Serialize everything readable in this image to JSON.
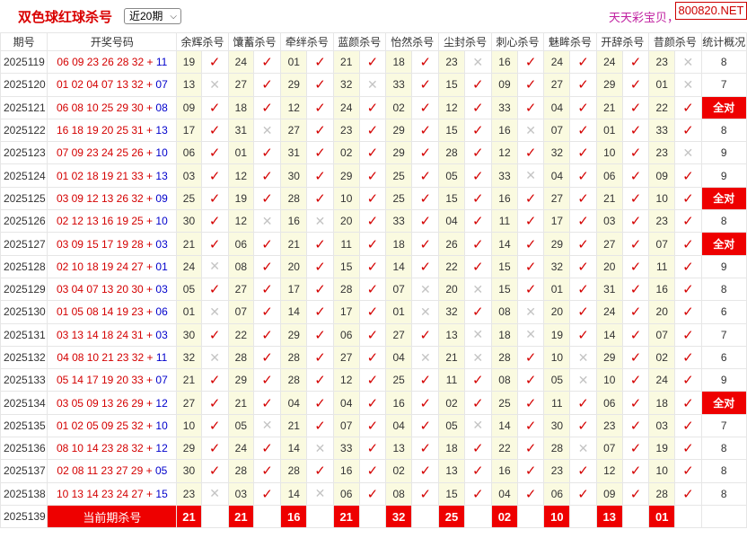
{
  "header": {
    "title": "双色球红球杀号",
    "period_select": "近20期",
    "brand": "天天彩宝贝，",
    "watermark": "800820.NET"
  },
  "columns": [
    "期号",
    "开奖号码",
    "余辉杀号",
    "馕蓄杀号",
    "牵绊杀号",
    "蓝颜杀号",
    "怡然杀号",
    "尘封杀号",
    "刺心杀号",
    "魅眸杀号",
    "开辞杀号",
    "昔颜杀号",
    "统计概况"
  ],
  "rows": [
    {
      "p": "2025119",
      "red": "06 09 23 26 28 32",
      "blue": "11",
      "k": [
        [
          "19",
          1
        ],
        [
          "24",
          1
        ],
        [
          "01",
          1
        ],
        [
          "21",
          1
        ],
        [
          "18",
          1
        ],
        [
          "23",
          0
        ],
        [
          "16",
          1
        ],
        [
          "24",
          1
        ],
        [
          "24",
          1
        ],
        [
          "23",
          0
        ]
      ],
      "s": "8"
    },
    {
      "p": "2025120",
      "red": "01 02 04 07 13 32",
      "blue": "07",
      "k": [
        [
          "13",
          0
        ],
        [
          "27",
          1
        ],
        [
          "29",
          1
        ],
        [
          "32",
          0
        ],
        [
          "33",
          1
        ],
        [
          "15",
          1
        ],
        [
          "09",
          1
        ],
        [
          "27",
          1
        ],
        [
          "29",
          1
        ],
        [
          "01",
          0
        ]
      ],
      "s": "7"
    },
    {
      "p": "2025121",
      "red": "06 08 10 25 29 30",
      "blue": "08",
      "k": [
        [
          "09",
          1
        ],
        [
          "18",
          1
        ],
        [
          "12",
          1
        ],
        [
          "24",
          1
        ],
        [
          "02",
          1
        ],
        [
          "12",
          1
        ],
        [
          "33",
          1
        ],
        [
          "04",
          1
        ],
        [
          "21",
          1
        ],
        [
          "22",
          1
        ]
      ],
      "s": "全对"
    },
    {
      "p": "2025122",
      "red": "16 18 19 20 25 31",
      "blue": "13",
      "k": [
        [
          "17",
          1
        ],
        [
          "31",
          0
        ],
        [
          "27",
          1
        ],
        [
          "23",
          1
        ],
        [
          "29",
          1
        ],
        [
          "15",
          1
        ],
        [
          "16",
          0
        ],
        [
          "07",
          1
        ],
        [
          "01",
          1
        ],
        [
          "33",
          1
        ]
      ],
      "s": "8"
    },
    {
      "p": "2025123",
      "red": "07 09 23 24 25 26",
      "blue": "10",
      "k": [
        [
          "06",
          1
        ],
        [
          "01",
          1
        ],
        [
          "31",
          1
        ],
        [
          "02",
          1
        ],
        [
          "29",
          1
        ],
        [
          "28",
          1
        ],
        [
          "12",
          1
        ],
        [
          "32",
          1
        ],
        [
          "10",
          1
        ],
        [
          "23",
          0
        ]
      ],
      "s": "9"
    },
    {
      "p": "2025124",
      "red": "01 02 18 19 21 33",
      "blue": "13",
      "k": [
        [
          "03",
          1
        ],
        [
          "12",
          1
        ],
        [
          "30",
          1
        ],
        [
          "29",
          1
        ],
        [
          "25",
          1
        ],
        [
          "05",
          1
        ],
        [
          "33",
          0
        ],
        [
          "04",
          1
        ],
        [
          "06",
          1
        ],
        [
          "09",
          1
        ]
      ],
      "s": "9"
    },
    {
      "p": "2025125",
      "red": "03 09 12 13 26 32",
      "blue": "09",
      "k": [
        [
          "25",
          1
        ],
        [
          "19",
          1
        ],
        [
          "28",
          1
        ],
        [
          "10",
          1
        ],
        [
          "25",
          1
        ],
        [
          "15",
          1
        ],
        [
          "16",
          1
        ],
        [
          "27",
          1
        ],
        [
          "21",
          1
        ],
        [
          "10",
          1
        ]
      ],
      "s": "全对"
    },
    {
      "p": "2025126",
      "red": "02 12 13 16 19 25",
      "blue": "10",
      "k": [
        [
          "30",
          1
        ],
        [
          "12",
          0
        ],
        [
          "16",
          0
        ],
        [
          "20",
          1
        ],
        [
          "33",
          1
        ],
        [
          "04",
          1
        ],
        [
          "11",
          1
        ],
        [
          "17",
          1
        ],
        [
          "03",
          1
        ],
        [
          "23",
          1
        ]
      ],
      "s": "8"
    },
    {
      "p": "2025127",
      "red": "03 09 15 17 19 28",
      "blue": "03",
      "k": [
        [
          "21",
          1
        ],
        [
          "06",
          1
        ],
        [
          "21",
          1
        ],
        [
          "11",
          1
        ],
        [
          "18",
          1
        ],
        [
          "26",
          1
        ],
        [
          "14",
          1
        ],
        [
          "29",
          1
        ],
        [
          "27",
          1
        ],
        [
          "07",
          1
        ]
      ],
      "s": "全对"
    },
    {
      "p": "2025128",
      "red": "02 10 18 19 24 27",
      "blue": "01",
      "k": [
        [
          "24",
          0
        ],
        [
          "08",
          1
        ],
        [
          "20",
          1
        ],
        [
          "15",
          1
        ],
        [
          "14",
          1
        ],
        [
          "22",
          1
        ],
        [
          "15",
          1
        ],
        [
          "32",
          1
        ],
        [
          "20",
          1
        ],
        [
          "11",
          1
        ]
      ],
      "s": "9"
    },
    {
      "p": "2025129",
      "red": "03 04 07 13 20 30",
      "blue": "03",
      "k": [
        [
          "05",
          1
        ],
        [
          "27",
          1
        ],
        [
          "17",
          1
        ],
        [
          "28",
          1
        ],
        [
          "07",
          0
        ],
        [
          "20",
          0
        ],
        [
          "15",
          1
        ],
        [
          "01",
          1
        ],
        [
          "31",
          1
        ],
        [
          "16",
          1
        ]
      ],
      "s": "8"
    },
    {
      "p": "2025130",
      "red": "01 05 08 14 19 23",
      "blue": "06",
      "k": [
        [
          "01",
          0
        ],
        [
          "07",
          1
        ],
        [
          "14",
          1
        ],
        [
          "17",
          1
        ],
        [
          "01",
          0
        ],
        [
          "32",
          1
        ],
        [
          "08",
          0
        ],
        [
          "20",
          1
        ],
        [
          "24",
          1
        ],
        [
          "20",
          1
        ]
      ],
      "s": "6"
    },
    {
      "p": "2025131",
      "red": "03 13 14 18 24 31",
      "blue": "03",
      "k": [
        [
          "30",
          1
        ],
        [
          "22",
          1
        ],
        [
          "29",
          1
        ],
        [
          "06",
          1
        ],
        [
          "27",
          1
        ],
        [
          "13",
          0
        ],
        [
          "18",
          0
        ],
        [
          "19",
          1
        ],
        [
          "14",
          1
        ],
        [
          "07",
          1
        ]
      ],
      "s": "7"
    },
    {
      "p": "2025132",
      "red": "04 08 10 21 23 32",
      "blue": "11",
      "k": [
        [
          "32",
          0
        ],
        [
          "28",
          1
        ],
        [
          "28",
          1
        ],
        [
          "27",
          1
        ],
        [
          "04",
          0
        ],
        [
          "21",
          0
        ],
        [
          "28",
          1
        ],
        [
          "10",
          0
        ],
        [
          "29",
          1
        ],
        [
          "02",
          1
        ]
      ],
      "s": "6"
    },
    {
      "p": "2025133",
      "red": "05 14 17 19 20 33",
      "blue": "07",
      "k": [
        [
          "21",
          1
        ],
        [
          "29",
          1
        ],
        [
          "28",
          1
        ],
        [
          "12",
          1
        ],
        [
          "25",
          1
        ],
        [
          "11",
          1
        ],
        [
          "08",
          1
        ],
        [
          "05",
          0
        ],
        [
          "10",
          1
        ],
        [
          "24",
          1
        ]
      ],
      "s": "9"
    },
    {
      "p": "2025134",
      "red": "03 05 09 13 26 29",
      "blue": "12",
      "k": [
        [
          "27",
          1
        ],
        [
          "21",
          1
        ],
        [
          "04",
          1
        ],
        [
          "04",
          1
        ],
        [
          "16",
          1
        ],
        [
          "02",
          1
        ],
        [
          "25",
          1
        ],
        [
          "11",
          1
        ],
        [
          "06",
          1
        ],
        [
          "18",
          1
        ]
      ],
      "s": "全对"
    },
    {
      "p": "2025135",
      "red": "01 02 05 09 25 32",
      "blue": "10",
      "k": [
        [
          "10",
          1
        ],
        [
          "05",
          0
        ],
        [
          "21",
          1
        ],
        [
          "07",
          1
        ],
        [
          "04",
          1
        ],
        [
          "05",
          0
        ],
        [
          "14",
          1
        ],
        [
          "30",
          1
        ],
        [
          "23",
          1
        ],
        [
          "03",
          1
        ]
      ],
      "s": "7"
    },
    {
      "p": "2025136",
      "red": "08 10 14 23 28 32",
      "blue": "12",
      "k": [
        [
          "29",
          1
        ],
        [
          "24",
          1
        ],
        [
          "14",
          0
        ],
        [
          "33",
          1
        ],
        [
          "13",
          1
        ],
        [
          "18",
          1
        ],
        [
          "22",
          1
        ],
        [
          "28",
          0
        ],
        [
          "07",
          1
        ],
        [
          "19",
          1
        ]
      ],
      "s": "8"
    },
    {
      "p": "2025137",
      "red": "02 08 11 23 27 29",
      "blue": "05",
      "k": [
        [
          "30",
          1
        ],
        [
          "28",
          1
        ],
        [
          "28",
          1
        ],
        [
          "16",
          1
        ],
        [
          "02",
          1
        ],
        [
          "13",
          1
        ],
        [
          "16",
          1
        ],
        [
          "23",
          1
        ],
        [
          "12",
          1
        ],
        [
          "10",
          1
        ]
      ],
      "s": "8"
    },
    {
      "p": "2025138",
      "red": "10 13 14 23 24 27",
      "blue": "15",
      "k": [
        [
          "23",
          0
        ],
        [
          "03",
          1
        ],
        [
          "14",
          0
        ],
        [
          "06",
          1
        ],
        [
          "08",
          1
        ],
        [
          "15",
          1
        ],
        [
          "04",
          1
        ],
        [
          "06",
          1
        ],
        [
          "09",
          1
        ],
        [
          "28",
          1
        ]
      ],
      "s": "8"
    }
  ],
  "current": {
    "p": "2025139",
    "label": "当前期杀号",
    "k": [
      "21",
      "21",
      "16",
      "21",
      "32",
      "25",
      "02",
      "10",
      "13",
      "01"
    ]
  },
  "icons": {
    "correct": "check-icon",
    "wrong": "cross-icon"
  }
}
